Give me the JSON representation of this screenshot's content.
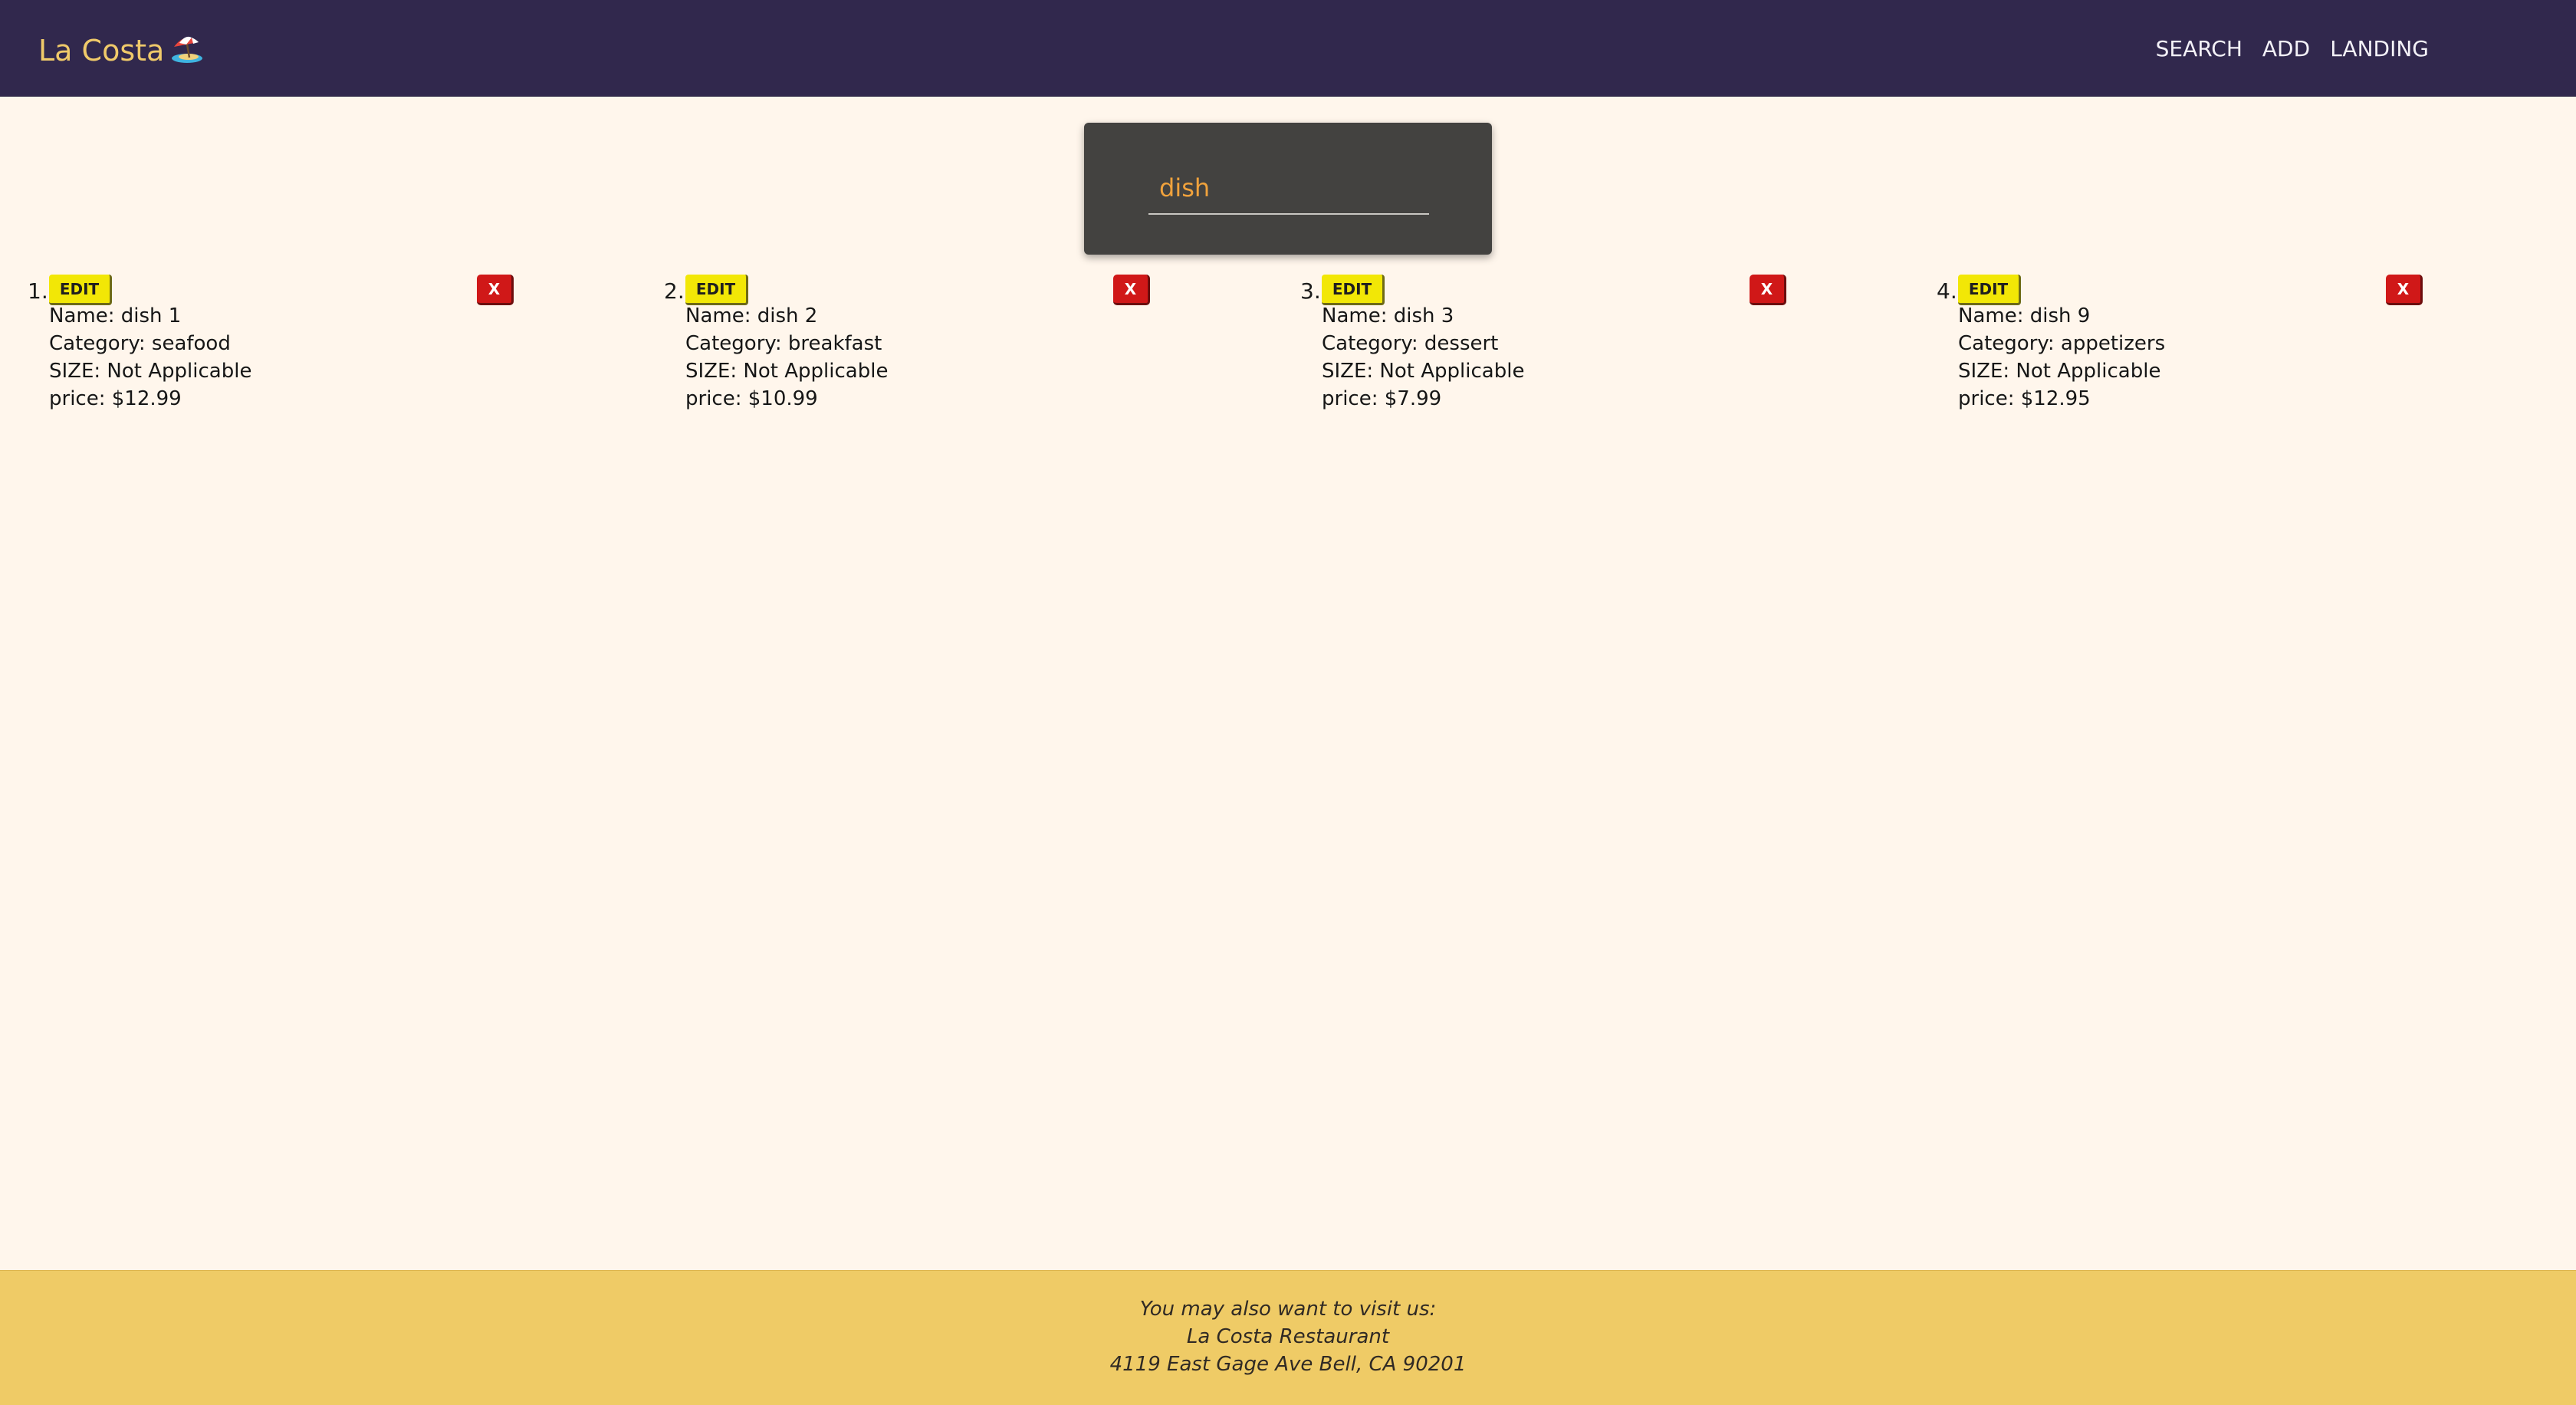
{
  "header": {
    "brand": "La Costa",
    "brand_icon": "beach-umbrella-icon",
    "nav": [
      {
        "label": "SEARCH"
      },
      {
        "label": "ADD"
      },
      {
        "label": "LANDING"
      }
    ]
  },
  "search": {
    "value": "dish",
    "placeholder": ""
  },
  "results": [
    {
      "number": "1.",
      "edit_label": "EDIT",
      "delete_label": "X",
      "name": "Name: dish 1",
      "category": "Category: seafood",
      "size": "SIZE: Not Applicable",
      "price": "price: $12.99"
    },
    {
      "number": "2.",
      "edit_label": "EDIT",
      "delete_label": "X",
      "name": "Name: dish 2",
      "category": "Category: breakfast",
      "size": "SIZE: Not Applicable",
      "price": "price: $10.99"
    },
    {
      "number": "3.",
      "edit_label": "EDIT",
      "delete_label": "X",
      "name": "Name: dish 3",
      "category": "Category: dessert",
      "size": "SIZE: Not Applicable",
      "price": "price: $7.99"
    },
    {
      "number": "4.",
      "edit_label": "EDIT",
      "delete_label": "X",
      "name": "Name: dish 9",
      "category": "Category: appetizers",
      "size": "SIZE: Not Applicable",
      "price": "price: $12.95"
    }
  ],
  "footer": {
    "line1": "You may also want to visit us:",
    "line2": "La Costa Restaurant",
    "line3": "4119 East Gage Ave Bell, CA 90201"
  },
  "colors": {
    "navbar": "#31284d",
    "brand": "#f0ca6a",
    "page_background": "#fff6ec",
    "edit_button": "#f2e706",
    "delete_button": "#d01818",
    "footer": "#efcb66",
    "search_text": "#f0a23c"
  }
}
